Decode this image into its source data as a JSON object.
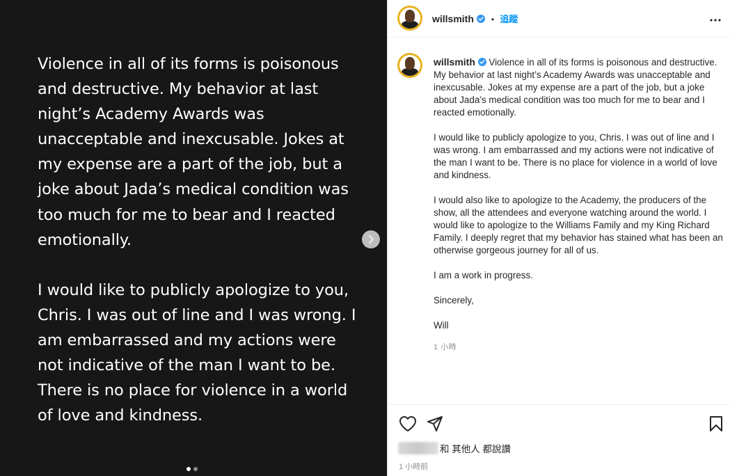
{
  "media": {
    "paragraphs": [
      "Violence in all of its forms is poisonous and destructive. My behavior at last night’s Academy Awards was unacceptable and inexcusable. Jokes at my expense are a part of the job, but a joke about Jada’s medical condition was too much for me to bear and I reacted emotionally.",
      "I would like to publicly apologize to you, Chris. I was out of line and I was wrong. I am embarrassed and my actions were not indicative of the man I want to be. There is no place for violence in a world of love and kindness."
    ],
    "carousel": {
      "count": 2,
      "active": 0
    }
  },
  "header": {
    "username": "willsmith",
    "separator": "•",
    "follow_label": "追蹤",
    "more_icon": "more-horizontal-icon"
  },
  "caption": {
    "username": "willsmith",
    "first_paragraph": "Violence in all of its forms is poisonous and destructive. My behavior at last night’s Academy Awards was unacceptable and inexcusable. Jokes at my expense are a part of the job, but a joke about Jada’s medical condition was too much for me to bear and I reacted emotionally.",
    "paragraphs": [
      "I would like to publicly apologize to you, Chris. I was out of line and I was wrong. I am embarrassed and my actions were not indicative of the man I want to be. There is no place for violence in a world of love and kindness.",
      "I would also like to apologize to the Academy, the producers of the show, all the attendees and everyone watching around the world. I would like to apologize to the Williams Family and my King Richard Family. I deeply regret that my behavior has stained what has been an otherwise gorgeous journey for all of us.",
      "I am a work in progress.",
      "Sincerely,",
      "Will"
    ],
    "time": "1 小時"
  },
  "actions": {
    "icons": [
      "heart-icon",
      "share-icon",
      "bookmark-icon"
    ],
    "likes_text": "和 其他人 都說讚",
    "posted_ago": "1 小時前"
  },
  "colors": {
    "media_bg": "#171717",
    "accent": "#0095f6",
    "verified": "#3897f0",
    "avatar_ring": "#e8b21f"
  }
}
